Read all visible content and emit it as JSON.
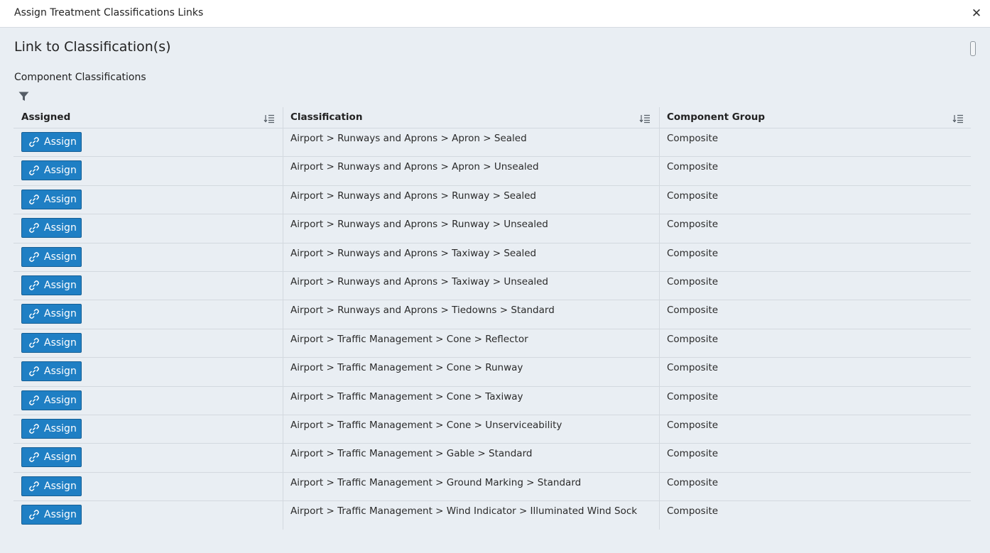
{
  "dialog": {
    "title": "Assign Treatment Classifications Links",
    "close_glyph": "✕",
    "section_title": "Link to Classification(s)",
    "subsection_title": "Component Classifications"
  },
  "icons": {
    "close": "close-icon",
    "filter": "filter-icon",
    "sort": "sort-icon",
    "link": "link-icon"
  },
  "colors": {
    "button_bg": "#1f7fc4",
    "button_border": "#155f95",
    "background": "#e9eef3",
    "titlebar_bg": "#ffffff"
  },
  "grid": {
    "columns": [
      "Assigned",
      "Classification",
      "Component Group"
    ],
    "rows": [
      {
        "action": "Assign",
        "classification": "Airport > Runways and Aprons > Apron > Sealed",
        "group": "Composite"
      },
      {
        "action": "Assign",
        "classification": "Airport > Runways and Aprons > Apron > Unsealed",
        "group": "Composite"
      },
      {
        "action": "Assign",
        "classification": "Airport > Runways and Aprons > Runway > Sealed",
        "group": "Composite"
      },
      {
        "action": "Assign",
        "classification": "Airport > Runways and Aprons > Runway > Unsealed",
        "group": "Composite"
      },
      {
        "action": "Assign",
        "classification": "Airport > Runways and Aprons > Taxiway > Sealed",
        "group": "Composite"
      },
      {
        "action": "Assign",
        "classification": "Airport > Runways and Aprons > Taxiway > Unsealed",
        "group": "Composite"
      },
      {
        "action": "Assign",
        "classification": "Airport > Runways and Aprons > Tiedowns > Standard",
        "group": "Composite"
      },
      {
        "action": "Assign",
        "classification": "Airport > Traffic Management > Cone > Reflector",
        "group": "Composite"
      },
      {
        "action": "Assign",
        "classification": "Airport > Traffic Management > Cone > Runway",
        "group": "Composite"
      },
      {
        "action": "Assign",
        "classification": "Airport > Traffic Management > Cone > Taxiway",
        "group": "Composite"
      },
      {
        "action": "Assign",
        "classification": "Airport > Traffic Management > Cone > Unserviceability",
        "group": "Composite"
      },
      {
        "action": "Assign",
        "classification": "Airport > Traffic Management > Gable > Standard",
        "group": "Composite"
      },
      {
        "action": "Assign",
        "classification": "Airport > Traffic Management > Ground Marking > Standard",
        "group": "Composite"
      },
      {
        "action": "Assign",
        "classification": "Airport > Traffic Management > Wind Indicator > Illuminated Wind Sock",
        "group": "Composite"
      }
    ]
  }
}
